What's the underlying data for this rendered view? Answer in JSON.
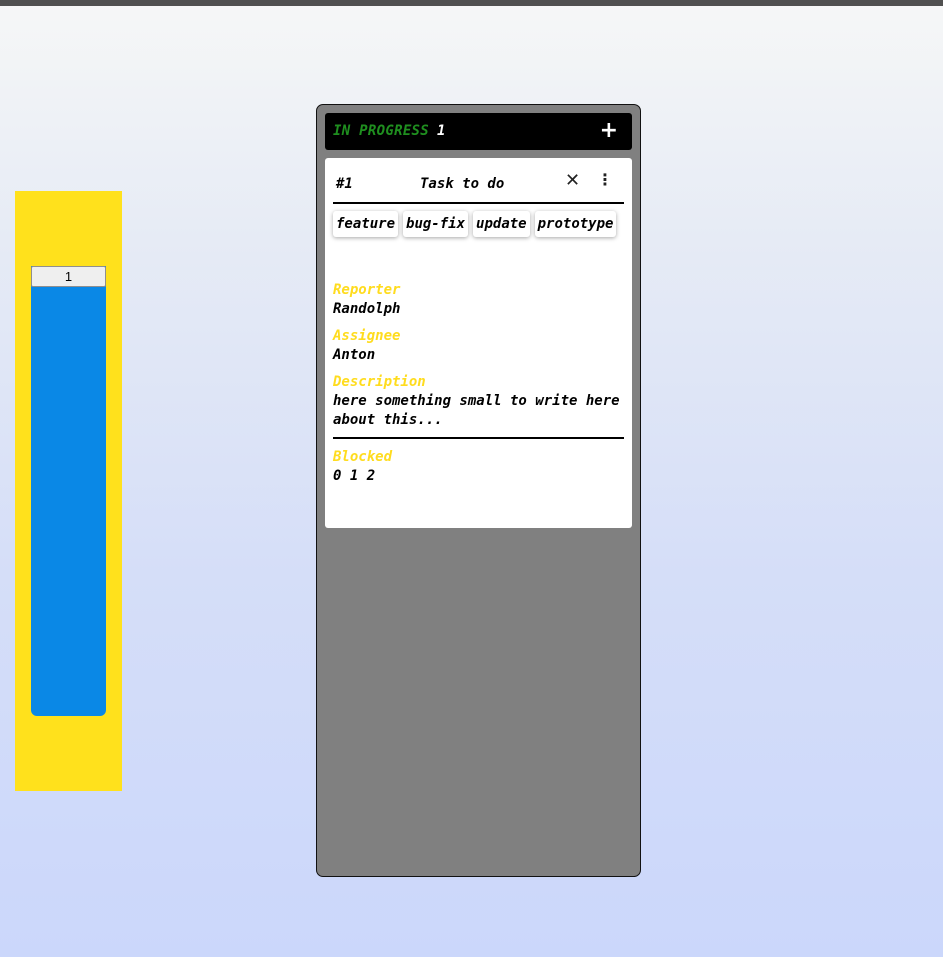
{
  "side_panel": {
    "button_label": "1"
  },
  "column": {
    "title": "IN PROGRESS",
    "count": "1",
    "add_label": "+"
  },
  "card": {
    "id": "#1",
    "title": "Task to do",
    "close_glyph": "✕",
    "menu_glyph": "⋮",
    "tags": [
      "feature",
      "bug-fix",
      "update",
      "prototype"
    ],
    "reporter_label": "Reporter",
    "reporter": "Randolph",
    "assignee_label": "Assignee",
    "assignee": "Anton",
    "description_label": "Description",
    "description": "here something small to write here about this...",
    "blocked_label": "Blocked",
    "blocked": "0 1 2"
  },
  "colors": {
    "side_panel": "#ffe11c",
    "side_column": "#0a88e6",
    "column_bg": "#808080",
    "header_bg": "#000000",
    "title_green": "#1f8f1f",
    "label_yellow": "#ffdc1e"
  }
}
